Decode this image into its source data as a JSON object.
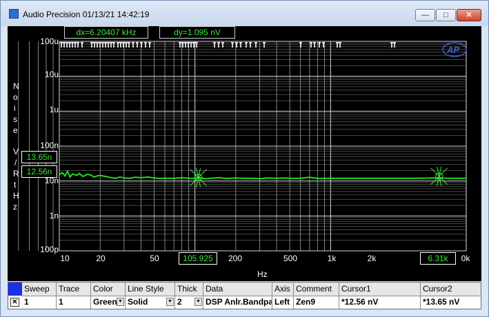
{
  "window": {
    "title": "Audio Precision  01/13/21 14:42:19",
    "controls": {
      "minimize": "—",
      "maximize": "□",
      "close": "✕"
    }
  },
  "readouts": {
    "dx": "dx=6.20407 kHz",
    "dy": "dy=1.095  nV"
  },
  "cursors": {
    "cursor1_x": "105.925",
    "cursor2_x": "6.31k",
    "cursor1_y": "12.56n",
    "cursor2_y": "13.65n"
  },
  "chart_data": {
    "type": "line",
    "title": "",
    "xlabel": "Hz",
    "ylabel": "Noise V/RtHz",
    "x_scale": "log",
    "y_scale": "log",
    "xlim": [
      10,
      10000
    ],
    "ylim": [
      1e-10,
      0.0001
    ],
    "grid": true,
    "y_tick_labels": [
      "100u",
      "10u",
      "1u",
      "100n",
      "10n",
      "1n",
      "100p"
    ],
    "x_tick_labels": [
      {
        "value": 10,
        "label": "10"
      },
      {
        "value": 20,
        "label": "20"
      },
      {
        "value": 50,
        "label": "50"
      },
      {
        "value": 200,
        "label": "200"
      },
      {
        "value": 500,
        "label": "500"
      },
      {
        "value": 1000,
        "label": "1k"
      },
      {
        "value": 2000,
        "label": "2k"
      },
      {
        "value": 10000,
        "label": "0k"
      }
    ],
    "series": [
      {
        "color": "#22dd22",
        "x": [
          10,
          10.5,
          11,
          11.5,
          12,
          12.5,
          13,
          13.5,
          14,
          15,
          16,
          17,
          18,
          19,
          20,
          22,
          24,
          26,
          28,
          30,
          33,
          36,
          40,
          45,
          50,
          55,
          60,
          70,
          80,
          90,
          100,
          105.9,
          110,
          120,
          130,
          150,
          170,
          200,
          230,
          260,
          300,
          350,
          400,
          450,
          500,
          600,
          700,
          800,
          900,
          1000,
          1200,
          1500,
          2000,
          2500,
          3000,
          4000,
          5000,
          6310,
          7000,
          8000,
          10000
        ],
        "y": [
          1.5e-08,
          1.75e-08,
          1.4e-08,
          1.9e-08,
          1.3e-08,
          1.6e-08,
          1.5e-08,
          1.45e-08,
          1.65e-08,
          1.35e-08,
          1.55e-08,
          1.5e-08,
          1.3e-08,
          1.4e-08,
          1.45e-08,
          1.35e-08,
          1.25e-08,
          1.2e-08,
          1.3e-08,
          1.22e-08,
          1.2e-08,
          1.28e-08,
          1.24e-08,
          1.3e-08,
          1.22e-08,
          1.18e-08,
          1.21e-08,
          1.19e-08,
          1.24e-08,
          1.2e-08,
          1.2e-08,
          1.3e-08,
          1.22e-08,
          1.16e-08,
          1.2e-08,
          1.25e-08,
          1.18e-08,
          1.22e-08,
          1.2e-08,
          1.2e-08,
          1.17e-08,
          1.22e-08,
          1.2e-08,
          1.22e-08,
          1.19e-08,
          1.2e-08,
          1.28e-08,
          1.18e-08,
          1.19e-08,
          1.19e-08,
          1.2e-08,
          1.2e-08,
          1.19e-08,
          1.2e-08,
          1.2e-08,
          1.19e-08,
          1.21e-08,
          1.23e-08,
          1.21e-08,
          1.2e-08,
          1.2e-08
        ]
      }
    ],
    "cursor_markers": [
      {
        "x": 105.925,
        "y": 1.256e-08
      },
      {
        "x": 6310,
        "y": 1.365e-08
      }
    ]
  },
  "trace_table": {
    "headers": [
      "Sweep",
      "Trace",
      "Color",
      "Line Style",
      "Thick",
      "Data",
      "Axis",
      "Comment",
      "Cursor1",
      "Cursor2"
    ],
    "row": {
      "checked": "✕",
      "sweep": "1",
      "trace": "1",
      "color": "Green",
      "line_style": "Solid",
      "thick": "2",
      "data": "DSP Anlr.Bandpa",
      "axis": "Left",
      "comment": "Zen9",
      "cursor1": "*12.56  nV",
      "cursor2": "*13.65  nV"
    },
    "colors": {
      "header_swatch": "#1a2fe8"
    }
  }
}
